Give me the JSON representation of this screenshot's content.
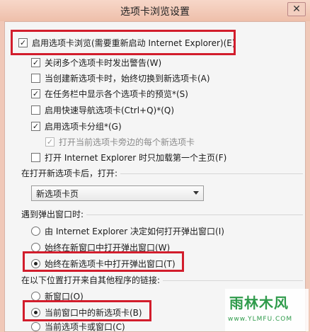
{
  "window": {
    "title": "选项卡浏览设置",
    "close_label": "✕"
  },
  "options": {
    "enable_tabs": {
      "label": "启用选项卡浏览(需要重新启动 Internet Explorer)(E)",
      "checked": true
    },
    "warn_close": {
      "label": "关闭多个选项卡时发出警告(W)",
      "checked": true
    },
    "switch_new_tab": {
      "label": "当创建新选项卡时，始终切换到新选项卡(A)",
      "checked": false
    },
    "taskbar_previews": {
      "label": "在任务栏中显示各个选项卡的预览*(S)",
      "checked": true
    },
    "quick_tabs": {
      "label": "启用快速导航选项卡(Ctrl+Q)*(Q)",
      "checked": false
    },
    "tab_groups": {
      "label": "启用选项卡分组*(G)",
      "checked": true
    },
    "open_next_to_current": {
      "label": "打开当前选项卡旁边的每个新选项卡",
      "checked": true
    },
    "load_first_home": {
      "label": "打开 Internet Explorer 时只加载第一个主页(F)",
      "checked": false
    }
  },
  "new_tab_section": {
    "label": "在打开新选项卡后，打开:",
    "selected": "新选项卡页"
  },
  "popup_section": {
    "label": "遇到弹出窗口时:",
    "options": [
      {
        "label": "由 Internet Explorer 决定如何打开弹出窗口(I)",
        "checked": false
      },
      {
        "label": "始终在新窗口中打开弹出窗口(W)",
        "checked": false
      },
      {
        "label": "始终在新选项卡中打开弹出窗口(T)",
        "checked": true
      }
    ]
  },
  "links_section": {
    "label": "在以下位置打开来自其他程序的链接:",
    "options": [
      {
        "label": "新窗口(O)",
        "checked": false
      },
      {
        "label": "当前窗口中的新选项卡(B)",
        "checked": true
      },
      {
        "label": "当前选项卡或窗口(C)",
        "checked": false
      }
    ]
  },
  "watermark": {
    "logo": "雨林木风",
    "url": "www.YLMFU.COM"
  },
  "colors": {
    "highlight": "#d21d2c",
    "dialog_bg": "#f5f5f5",
    "title_bg": "#eebfaa"
  }
}
